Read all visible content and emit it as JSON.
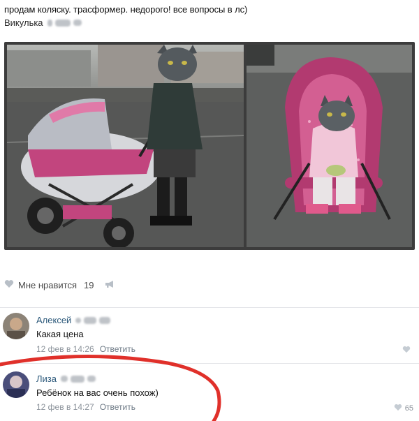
{
  "post": {
    "text": "продам коляску. трасформер. недорого! все вопросы в лс)",
    "author": "Викулька"
  },
  "likes": {
    "label": "Мне нравится",
    "count": "19"
  },
  "comments": [
    {
      "name": "Алексей",
      "text": "Какая цена",
      "date": "12 фев в 14:26",
      "reply": "Ответить",
      "like_count": ""
    },
    {
      "name": "Лиза",
      "text": "Ребёнок на вас очень похож)",
      "date": "12 фев в 14:27",
      "reply": "Ответить",
      "like_count": "65"
    }
  ],
  "icons": {
    "heart": "heart-icon",
    "share": "megaphone-icon",
    "like_small": "heart-small-icon"
  },
  "colors": {
    "link": "#2b587a",
    "meta": "#8b929a",
    "stroke_red": "#e0302a",
    "stroller_pink": "#c2457e"
  }
}
